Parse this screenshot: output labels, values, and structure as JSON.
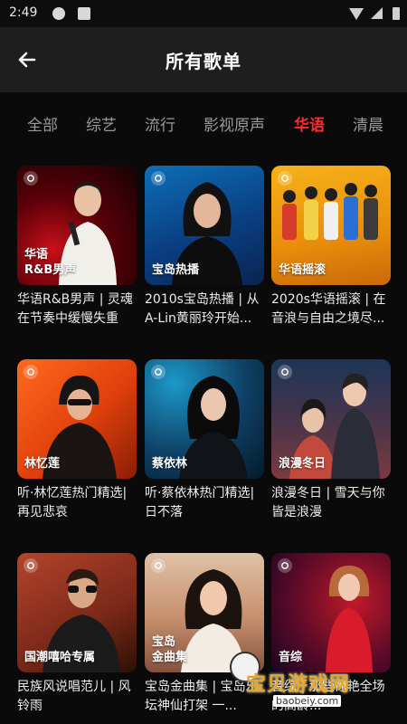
{
  "status_bar": {
    "time": "2:49"
  },
  "header": {
    "title": "所有歌单"
  },
  "tabs": [
    {
      "label": "全部",
      "active": false
    },
    {
      "label": "综艺",
      "active": false
    },
    {
      "label": "流行",
      "active": false
    },
    {
      "label": "影视原声",
      "active": false
    },
    {
      "label": "华语",
      "active": true
    },
    {
      "label": "清晨",
      "active": false
    }
  ],
  "playlists": [
    {
      "cover_label": "华语\nR&B男声",
      "caption": "华语R&B男声 | 灵魂在节奏中缓慢失重"
    },
    {
      "cover_label": "宝岛热播",
      "caption": "2010s宝岛热播 | 从A-Lin黄丽玲开始..."
    },
    {
      "cover_label": "华语摇滚",
      "caption": "2020s华语摇滚 | 在音浪与自由之境尽..."
    },
    {
      "cover_label": "林忆莲",
      "caption": "听·林忆莲热门精选| 再见悲哀"
    },
    {
      "cover_label": "蔡依林",
      "caption": "听·蔡依林热门精选| 日不落"
    },
    {
      "cover_label": "浪漫冬日",
      "caption": "浪漫冬日 | 雪天与你 皆是浪漫"
    },
    {
      "cover_label": "国潮嘻哈专属",
      "caption": "民族风说唱范儿 | 风铃雨"
    },
    {
      "cover_label": "宝岛\n金曲集",
      "caption": "宝岛金曲集 | 宝岛乐坛神仙打架 一..."
    },
    {
      "cover_label": "音综",
      "caption": "音综 | 那些惊艳全场的高龄..."
    }
  ],
  "watermark": {
    "text": "宝贝游戏网",
    "url": "baobeiy.com"
  },
  "colors": {
    "accent": "#ff2a2a",
    "nav_bg": "#1e1e1e",
    "page_bg": "#0a0a0a"
  }
}
